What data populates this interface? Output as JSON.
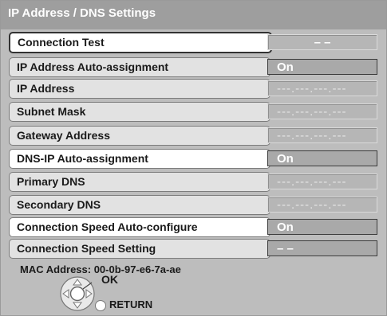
{
  "title": "IP Address / DNS Settings",
  "rows": [
    {
      "label": "Connection Test",
      "value": "– –"
    },
    {
      "label": "IP Address Auto-assignment",
      "value": "On"
    },
    {
      "label": "IP Address",
      "value": "---.---.---.---"
    },
    {
      "label": "Subnet Mask",
      "value": "---.---.---.---"
    },
    {
      "label": "Gateway Address",
      "value": "---.---.---.---"
    },
    {
      "label": "DNS-IP Auto-assignment",
      "value": "On"
    },
    {
      "label": "Primary DNS",
      "value": "---.---.---.---"
    },
    {
      "label": "Secondary DNS",
      "value": "---.---.---.---"
    },
    {
      "label": "Connection Speed Auto-configure",
      "value": "On"
    },
    {
      "label": "Connection Speed Setting",
      "value": "– –"
    }
  ],
  "footer": {
    "mac_address": "MAC Address: 00-0b-97-e6-7a-ae",
    "ok_label": "OK",
    "return_label": "RETURN",
    "icons": [
      "directional-pad-icon",
      "return-button-icon"
    ]
  }
}
